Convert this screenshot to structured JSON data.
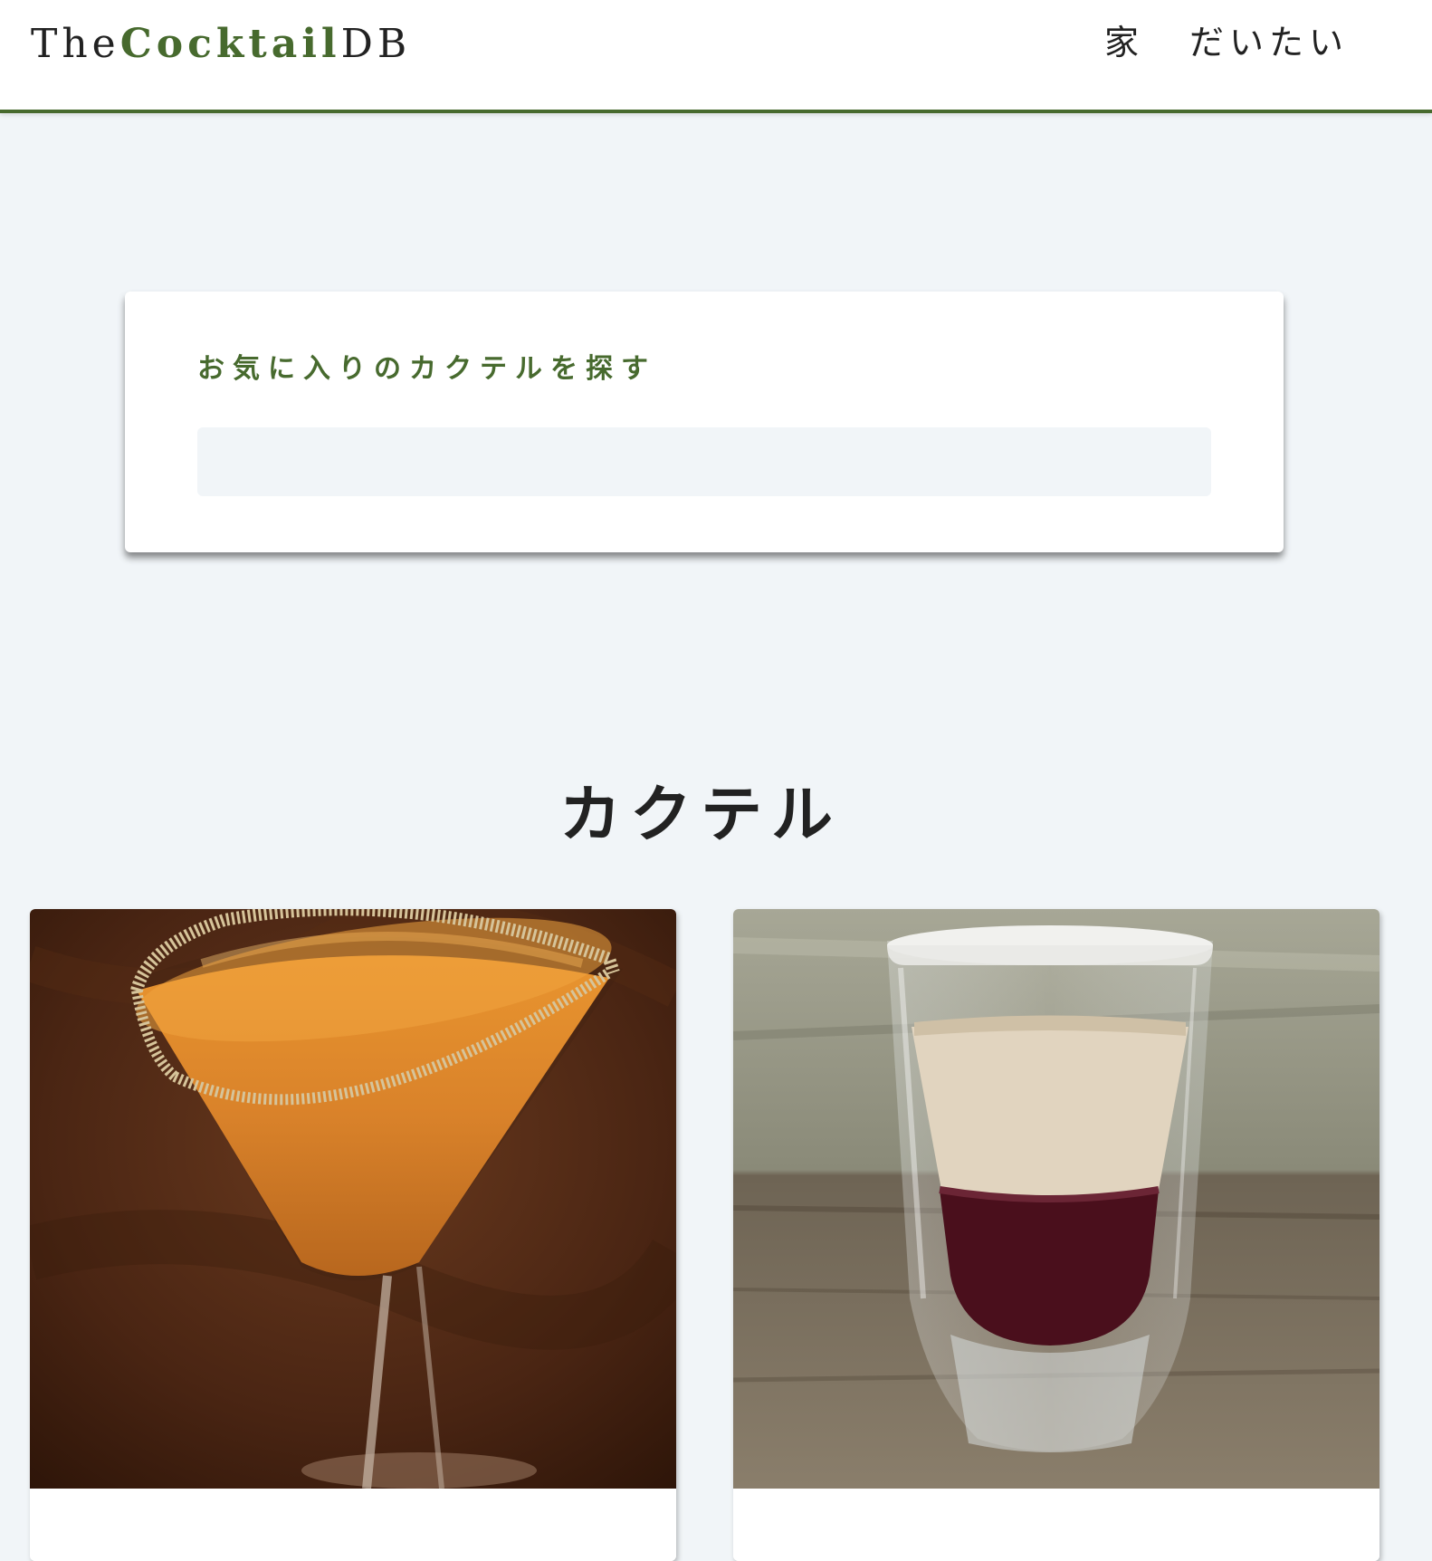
{
  "navbar": {
    "logo_prefix": "The",
    "logo_accent": "Cocktail",
    "logo_suffix": "DB",
    "links": [
      {
        "label": "家"
      },
      {
        "label": "だいたい"
      }
    ]
  },
  "search": {
    "label": "お気に入りのカクテルを探す",
    "value": "",
    "placeholder": ""
  },
  "section": {
    "title": "カクテル"
  },
  "colors": {
    "accent": "#476a2e",
    "background": "#f1f5f8",
    "text": "#222222"
  }
}
